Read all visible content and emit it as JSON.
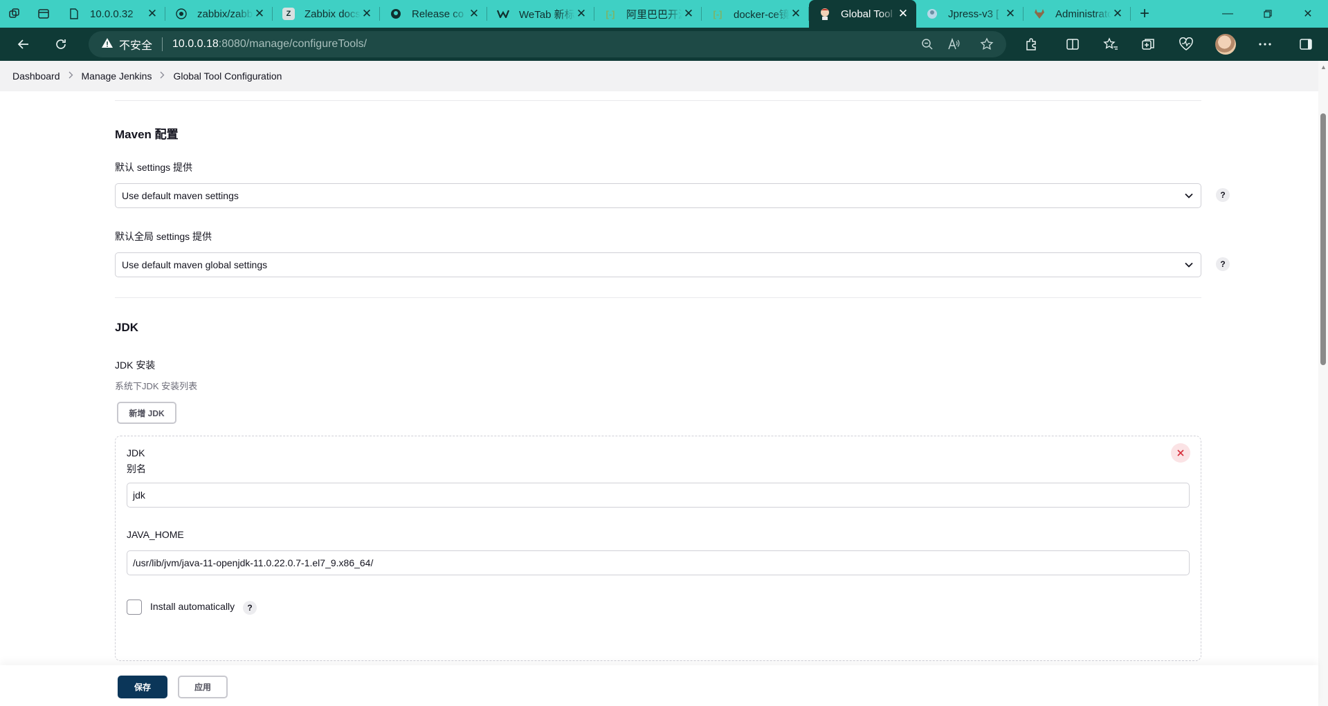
{
  "browser": {
    "tabs": [
      {
        "title": "10.0.0.32",
        "icon": "page-icon",
        "active": false
      },
      {
        "title": "zabbix/zabbix",
        "icon": "zabbix-icon",
        "active": false
      },
      {
        "title": "Zabbix docs",
        "icon": "zabbix-z-icon",
        "active": false
      },
      {
        "title": "Release co",
        "icon": "github-icon",
        "active": false
      },
      {
        "title": "WeTab 新标签页",
        "icon": "wetab-icon",
        "active": false
      },
      {
        "title": "阿里巴巴开源",
        "icon": "aliyun-icon",
        "active": false
      },
      {
        "title": "docker-ce镜像",
        "icon": "aliyun-icon",
        "active": false
      },
      {
        "title": "Global Tool",
        "icon": "jenkins-icon",
        "active": true
      },
      {
        "title": "Jpress-v3 [",
        "icon": "gitee-icon",
        "active": false
      },
      {
        "title": "Administrator",
        "icon": "gitlab-icon",
        "active": false
      }
    ],
    "address": {
      "security_label": "不安全",
      "url_host": "10.0.0.18",
      "url_rest": ":8080/manage/configureTools/"
    }
  },
  "breadcrumb": {
    "items": [
      "Dashboard",
      "Manage Jenkins",
      "Global Tool Configuration"
    ]
  },
  "maven": {
    "title": "Maven 配置",
    "settings_label": "默认 settings 提供",
    "settings_value": "Use default maven settings",
    "global_settings_label": "默认全局 settings 提供",
    "global_settings_value": "Use default maven global settings"
  },
  "jdk": {
    "title": "JDK",
    "install_label": "JDK 安装",
    "install_desc": "系统下JDK 安装列表",
    "add_button": "新增 JDK",
    "entry": {
      "heading": "JDK",
      "name_label": "别名",
      "name_value": "jdk",
      "home_label": "JAVA_HOME",
      "home_value": "/usr/lib/jvm/java-11-openjdk-11.0.22.0.7-1.el7_9.x86_64/",
      "auto_install_label": "Install automatically",
      "auto_install_checked": false
    }
  },
  "help_glyph": "?",
  "actions": {
    "save": "保存",
    "apply": "应用"
  },
  "colors": {
    "tabstrip": "#3fd0c4",
    "toolbar": "#0f3a36",
    "primary_button": "#0b3659",
    "delete": "#d62d3a"
  }
}
